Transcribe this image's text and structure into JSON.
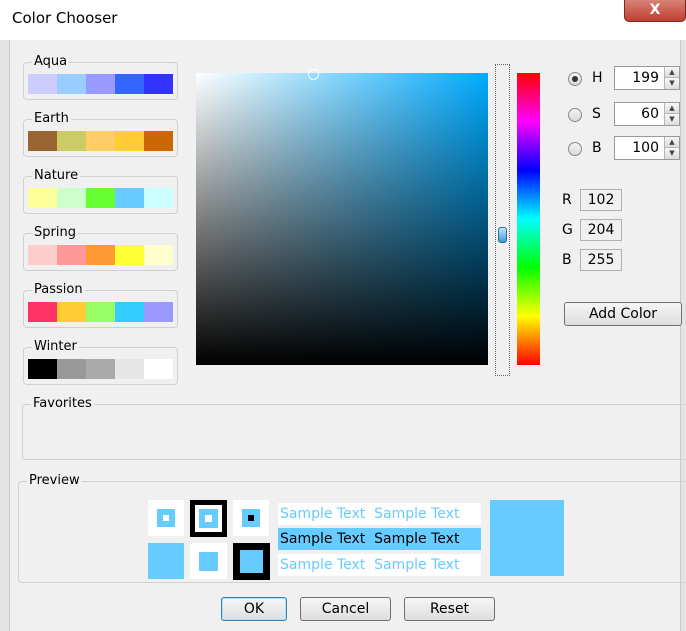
{
  "window": {
    "title": "Color Chooser",
    "close_glyph": "X",
    "close_icon": "close-icon"
  },
  "palettes": [
    {
      "name": "Aqua",
      "colors": [
        "#ccccff",
        "#99ccff",
        "#9999ff",
        "#3366ff",
        "#3333ff"
      ]
    },
    {
      "name": "Earth",
      "colors": [
        "#996633",
        "#cccc66",
        "#ffcc66",
        "#ffcc33",
        "#cc6600"
      ]
    },
    {
      "name": "Nature",
      "colors": [
        "#ffff99",
        "#ccffcc",
        "#66ff33",
        "#66ccff",
        "#ccffff"
      ]
    },
    {
      "name": "Spring",
      "colors": [
        "#ffcccc",
        "#ff9999",
        "#ff9933",
        "#ffff33",
        "#ffffcc"
      ]
    },
    {
      "name": "Passion",
      "colors": [
        "#ff3366",
        "#ffcc33",
        "#99ff66",
        "#33ccff",
        "#9999ff"
      ]
    },
    {
      "name": "Winter",
      "colors": [
        "#000000",
        "#999999",
        "#aaaaaa",
        "#e6e6e6",
        "#ffffff"
      ]
    }
  ],
  "favorites": {
    "label": "Favorites"
  },
  "hsb": {
    "h": {
      "label": "H",
      "value": "199",
      "selected": true
    },
    "s": {
      "label": "S",
      "value": "60",
      "selected": false
    },
    "b": {
      "label": "B",
      "value": "100",
      "selected": false
    }
  },
  "rgb": {
    "r": {
      "label": "R",
      "value": "102"
    },
    "g": {
      "label": "G",
      "value": "204"
    },
    "b": {
      "label": "B",
      "value": "255"
    }
  },
  "add_color_label": "Add Color",
  "preview": {
    "label": "Preview",
    "selected_color": "#66ccff",
    "sample_text": "Sample Text"
  },
  "buttons": {
    "ok": "OK",
    "cancel": "Cancel",
    "reset": "Reset"
  },
  "spinner": {
    "up": "▲",
    "down": "▼"
  }
}
